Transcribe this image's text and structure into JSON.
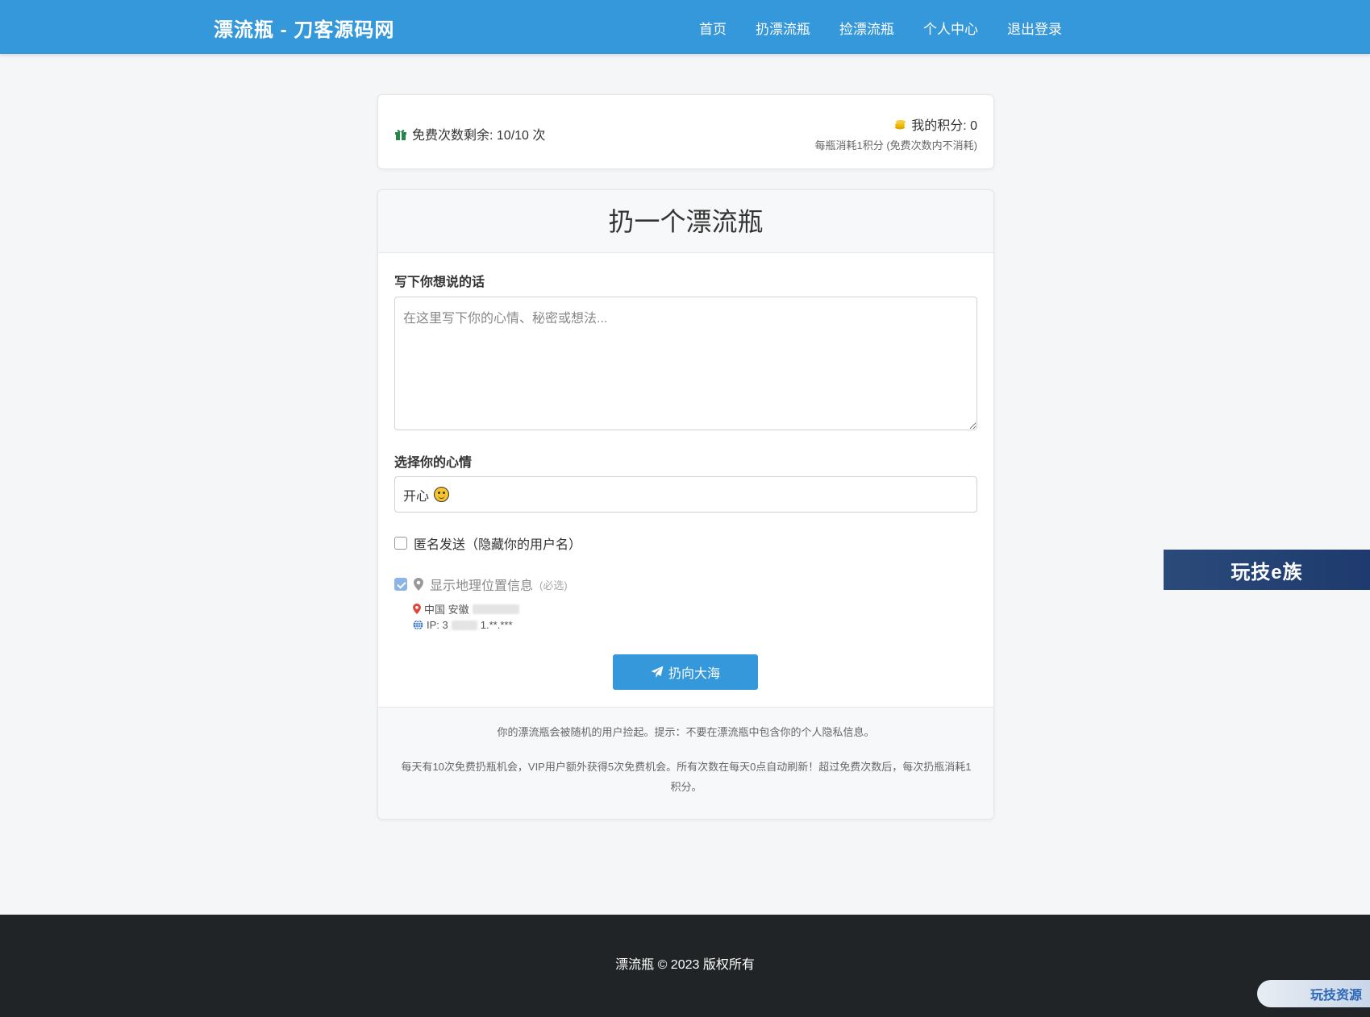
{
  "navbar": {
    "brand": "漂流瓶 - 刀客源码网",
    "links": [
      "首页",
      "扔漂流瓶",
      "捡漂流瓶",
      "个人中心",
      "退出登录"
    ]
  },
  "status": {
    "free_count": "免费次数剩余: 10/10 次",
    "points": "我的积分: 0",
    "points_note": "每瓶消耗1积分 (免费次数内不消耗)"
  },
  "form": {
    "title": "扔一个漂流瓶",
    "message_label": "写下你想说的话",
    "message_placeholder": "在这里写下你的心情、秘密或想法...",
    "message_value": "",
    "mood_label": "选择你的心情",
    "mood_value": "开心",
    "anonymous_label": "匿名发送（隐藏你的用户名）",
    "anonymous_checked": false,
    "geo_label": "显示地理位置信息",
    "geo_required": "(必选)",
    "geo_checked": true,
    "location": "中国 安徽",
    "ip_prefix": "IP: 3",
    "ip_suffix": "1.**.***",
    "submit_label": "扔向大海",
    "note1": "你的漂流瓶会被随机的用户捡起。提示：不要在漂流瓶中包含你的个人隐私信息。",
    "note2": "每天有10次免费扔瓶机会，VIP用户额外获得5次免费机会。所有次数在每天0点自动刷新！超过免费次数后，每次扔瓶消耗1积分。"
  },
  "footer": {
    "copyright": "漂流瓶 © 2023 版权所有"
  },
  "overlays": {
    "ad_text": "玩技e族",
    "watermark": "玩技资源"
  },
  "colors": {
    "primary": "#3498db",
    "footer": "#212426",
    "gift_icon": "#27864a",
    "coin_icon": "#f0b90b",
    "location_pin": "#e0443a",
    "globe": "#2c6fc9"
  }
}
